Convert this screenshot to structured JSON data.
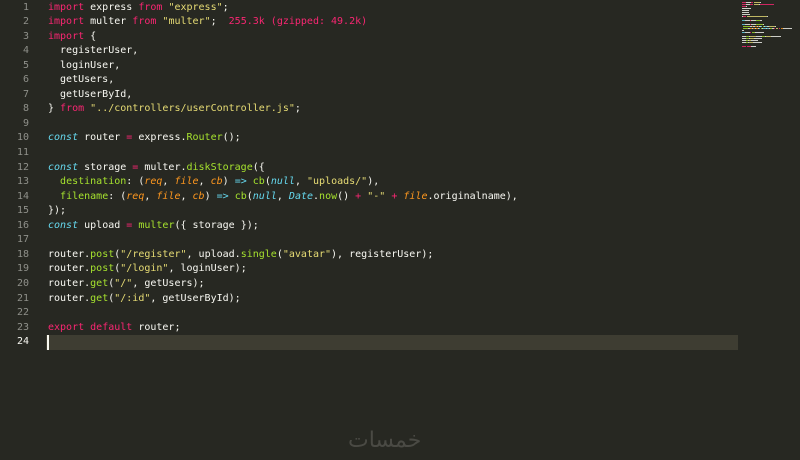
{
  "editor": {
    "lines": [
      {
        "num": "1",
        "segments": [
          [
            "kw",
            "import"
          ],
          [
            "pl",
            " express "
          ],
          [
            "kw",
            "from"
          ],
          [
            "pl",
            " "
          ],
          [
            "st",
            "\"express\""
          ],
          [
            "pl",
            ";"
          ]
        ]
      },
      {
        "num": "2",
        "segments": [
          [
            "kw",
            "import"
          ],
          [
            "pl",
            " multer "
          ],
          [
            "kw",
            "from"
          ],
          [
            "pl",
            " "
          ],
          [
            "st",
            "\"multer\""
          ],
          [
            "pl",
            ";  "
          ],
          [
            "sz",
            "255.3k (gzipped: 49.2k)"
          ]
        ]
      },
      {
        "num": "3",
        "segments": [
          [
            "kw",
            "import"
          ],
          [
            "pl",
            " {"
          ]
        ]
      },
      {
        "num": "4",
        "segments": [
          [
            "pl",
            "  registerUser,"
          ]
        ]
      },
      {
        "num": "5",
        "segments": [
          [
            "pl",
            "  loginUser,"
          ]
        ]
      },
      {
        "num": "6",
        "segments": [
          [
            "pl",
            "  getUsers,"
          ]
        ]
      },
      {
        "num": "7",
        "segments": [
          [
            "pl",
            "  getUserById,"
          ]
        ]
      },
      {
        "num": "8",
        "segments": [
          [
            "pl",
            "} "
          ],
          [
            "kw",
            "from"
          ],
          [
            "pl",
            " "
          ],
          [
            "st",
            "\"../controllers/userController.js\""
          ],
          [
            "pl",
            ";"
          ]
        ]
      },
      {
        "num": "9",
        "segments": []
      },
      {
        "num": "10",
        "segments": [
          [
            "bl",
            "const"
          ],
          [
            "pl",
            " router "
          ],
          [
            "kw",
            "="
          ],
          [
            "pl",
            " express."
          ],
          [
            "fn",
            "Router"
          ],
          [
            "pl",
            "();"
          ]
        ]
      },
      {
        "num": "11",
        "segments": []
      },
      {
        "num": "12",
        "segments": [
          [
            "bl",
            "const"
          ],
          [
            "pl",
            " storage "
          ],
          [
            "kw",
            "="
          ],
          [
            "pl",
            " multer."
          ],
          [
            "fn",
            "diskStorage"
          ],
          [
            "pl",
            "({"
          ]
        ]
      },
      {
        "num": "13",
        "segments": [
          [
            "pl",
            "  "
          ],
          [
            "fn",
            "destination"
          ],
          [
            "pl",
            ": ("
          ],
          [
            "it",
            "req"
          ],
          [
            "pl",
            ", "
          ],
          [
            "it",
            "file"
          ],
          [
            "pl",
            ", "
          ],
          [
            "it",
            "cb"
          ],
          [
            "pl",
            ") "
          ],
          [
            "bl",
            "=>"
          ],
          [
            "pl",
            " "
          ],
          [
            "fn",
            "cb"
          ],
          [
            "pl",
            "("
          ],
          [
            "bl",
            "null"
          ],
          [
            "pl",
            ", "
          ],
          [
            "st",
            "\"uploads/\""
          ],
          [
            "pl",
            "),"
          ]
        ]
      },
      {
        "num": "14",
        "segments": [
          [
            "pl",
            "  "
          ],
          [
            "fn",
            "filename"
          ],
          [
            "pl",
            ": ("
          ],
          [
            "it",
            "req"
          ],
          [
            "pl",
            ", "
          ],
          [
            "it",
            "file"
          ],
          [
            "pl",
            ", "
          ],
          [
            "it",
            "cb"
          ],
          [
            "pl",
            ") "
          ],
          [
            "bl",
            "=>"
          ],
          [
            "pl",
            " "
          ],
          [
            "fn",
            "cb"
          ],
          [
            "pl",
            "("
          ],
          [
            "bl",
            "null"
          ],
          [
            "pl",
            ", "
          ],
          [
            "bl",
            "Date"
          ],
          [
            "pl",
            "."
          ],
          [
            "fn",
            "now"
          ],
          [
            "pl",
            "() "
          ],
          [
            "kw",
            "+"
          ],
          [
            "pl",
            " "
          ],
          [
            "st",
            "\"-\""
          ],
          [
            "pl",
            " "
          ],
          [
            "kw",
            "+"
          ],
          [
            "pl",
            " "
          ],
          [
            "it",
            "file"
          ],
          [
            "pl",
            ".originalname),"
          ]
        ]
      },
      {
        "num": "15",
        "segments": [
          [
            "pl",
            "});"
          ]
        ]
      },
      {
        "num": "16",
        "segments": [
          [
            "bl",
            "const"
          ],
          [
            "pl",
            " upload "
          ],
          [
            "kw",
            "="
          ],
          [
            "pl",
            " "
          ],
          [
            "fn",
            "multer"
          ],
          [
            "pl",
            "({ storage });"
          ]
        ]
      },
      {
        "num": "17",
        "segments": []
      },
      {
        "num": "18",
        "segments": [
          [
            "pl",
            "router."
          ],
          [
            "fn",
            "post"
          ],
          [
            "pl",
            "("
          ],
          [
            "st",
            "\"/register\""
          ],
          [
            "pl",
            ", upload."
          ],
          [
            "fn",
            "single"
          ],
          [
            "pl",
            "("
          ],
          [
            "st",
            "\"avatar\""
          ],
          [
            "pl",
            "), registerUser);"
          ]
        ]
      },
      {
        "num": "19",
        "segments": [
          [
            "pl",
            "router."
          ],
          [
            "fn",
            "post"
          ],
          [
            "pl",
            "("
          ],
          [
            "st",
            "\"/login\""
          ],
          [
            "pl",
            ", loginUser);"
          ]
        ]
      },
      {
        "num": "20",
        "segments": [
          [
            "pl",
            "router."
          ],
          [
            "fn",
            "get"
          ],
          [
            "pl",
            "("
          ],
          [
            "st",
            "\"/\""
          ],
          [
            "pl",
            ", getUsers);"
          ]
        ]
      },
      {
        "num": "21",
        "segments": [
          [
            "pl",
            "router."
          ],
          [
            "fn",
            "get"
          ],
          [
            "pl",
            "("
          ],
          [
            "st",
            "\"/:id\""
          ],
          [
            "pl",
            ", getUserById);"
          ]
        ]
      },
      {
        "num": "22",
        "segments": []
      },
      {
        "num": "23",
        "segments": [
          [
            "kw",
            "export"
          ],
          [
            "pl",
            " "
          ],
          [
            "kw",
            "default"
          ],
          [
            "pl",
            " router;"
          ]
        ]
      },
      {
        "num": "24",
        "segments": [],
        "current": true
      }
    ]
  },
  "watermark": "خمسات",
  "colors": {
    "background": "#272822",
    "keyword": "#f92672",
    "string": "#e6db74",
    "function": "#a6e22e",
    "parameter": "#fd971f",
    "storage": "#66d9ef",
    "text": "#f8f8f2"
  }
}
